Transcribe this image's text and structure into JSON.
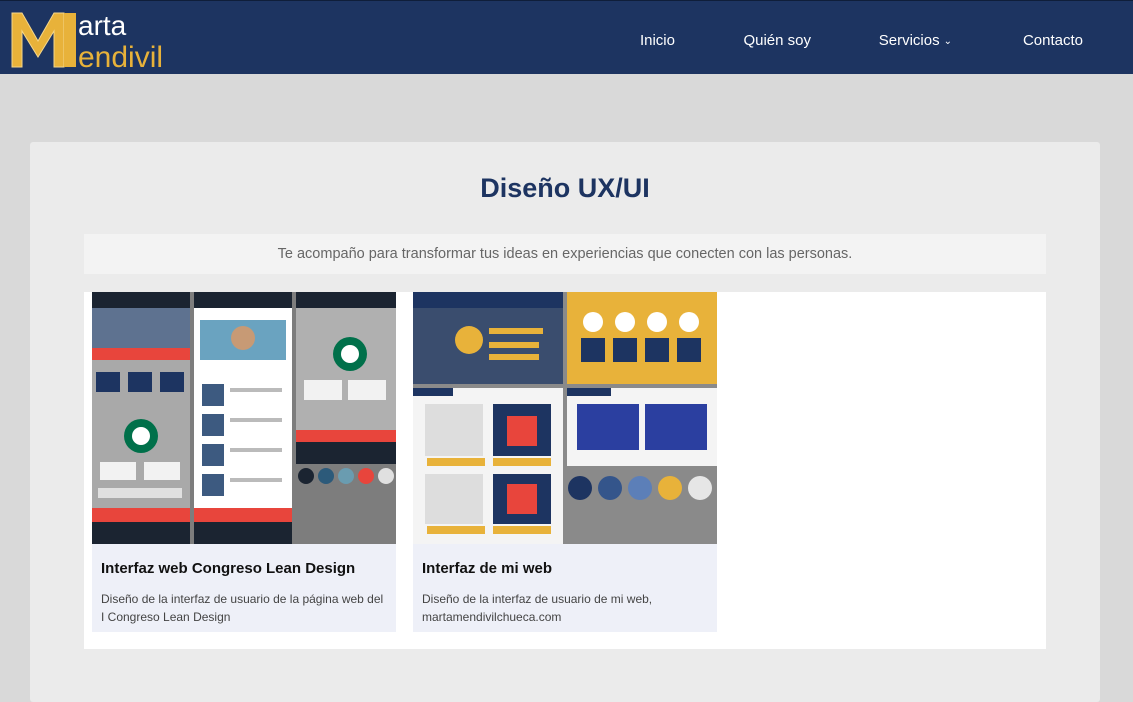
{
  "brand": {
    "logo_line1": "arta",
    "logo_line2": "endivil",
    "logo_letter": "M"
  },
  "nav": {
    "items": [
      {
        "label": "Inicio"
      },
      {
        "label": "Quién soy"
      },
      {
        "label": "Servicios"
      },
      {
        "label": "Contacto"
      }
    ]
  },
  "section": {
    "title": "Diseño UX/UI",
    "subtitle": "Te acompaño para transformar tus ideas en experiencias que conecten con las personas."
  },
  "cards": [
    {
      "title": "Interfaz web Congreso Lean Design",
      "description": "Diseño de la interfaz de usuario de la página web del I Congreso Lean Design"
    },
    {
      "title": "Interfaz de mi web",
      "description": "Diseño de la interfaz de usuario de mi web, martamendivilchueca.com"
    }
  ],
  "colors": {
    "navbar": "#1d3461",
    "accent_gold": "#e8b23a",
    "accent_red": "#e8453c",
    "panel": "#ebebeb"
  }
}
